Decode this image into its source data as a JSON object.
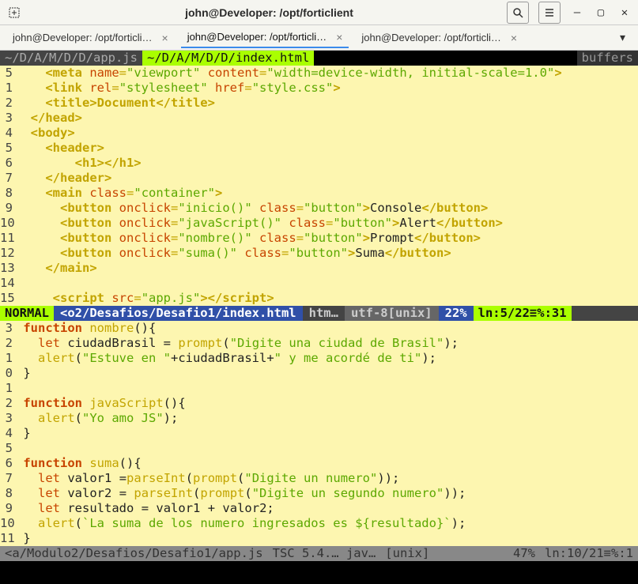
{
  "window": {
    "title": "john@Developer: /opt/forticlient",
    "controls": {
      "minimize": "—",
      "maximize": "▢",
      "close": "✕",
      "search": "🔍",
      "menu": "≡"
    }
  },
  "tabs": [
    {
      "label": "john@Developer: /opt/forticli…",
      "active": false
    },
    {
      "label": "john@Developer: /opt/forticli…",
      "active": true
    },
    {
      "label": "john@Developer: /opt/forticli…",
      "active": false
    }
  ],
  "buftabs": {
    "left": "~/D/A/M/D/D/app.js",
    "active": "~/D/A/M/D/D/index.html",
    "right": "buffers"
  },
  "pane1": {
    "lines": [
      {
        "n": "5"
      },
      {
        "n": "1"
      },
      {
        "n": "2"
      },
      {
        "n": "3"
      },
      {
        "n": "4"
      },
      {
        "n": "5"
      },
      {
        "n": "6"
      },
      {
        "n": "7"
      },
      {
        "n": "8"
      },
      {
        "n": "9"
      },
      {
        "n": "10"
      },
      {
        "n": "11"
      },
      {
        "n": "12"
      },
      {
        "n": "13"
      },
      {
        "n": "14"
      },
      {
        "n": "15"
      }
    ],
    "meta": {
      "name": "viewport",
      "content": "width=device-width, initial-scale=1.0"
    },
    "link": {
      "rel": "stylesheet",
      "href": "style.css"
    },
    "title": "Document",
    "main_class": "container",
    "buttons": [
      {
        "onclick": "inicio()",
        "class": "button",
        "text": "Console"
      },
      {
        "onclick": "javaScript()",
        "class": "button",
        "text": "Alert"
      },
      {
        "onclick": "nombre()",
        "class": "button",
        "text": "Prompt"
      },
      {
        "onclick": "suma()",
        "class": "button",
        "text": "Suma"
      }
    ],
    "script_src": "app.js"
  },
  "statusline1": {
    "mode": "NORMAL",
    "file": "<o2/Desafios/Desafio1/index.html",
    "ft": "htm…",
    "enc": "utf-8[unix]",
    "pct": "22%",
    "pos": "ln:5/22≡%:31"
  },
  "pane2": {
    "lines": [
      {
        "n": "3"
      },
      {
        "n": "2"
      },
      {
        "n": "1"
      },
      {
        "n": "0"
      },
      {
        "n": "1"
      },
      {
        "n": "2"
      },
      {
        "n": "3"
      },
      {
        "n": "4"
      },
      {
        "n": "5"
      },
      {
        "n": "6"
      },
      {
        "n": "7"
      },
      {
        "n": "8"
      },
      {
        "n": "9"
      },
      {
        "n": "10"
      },
      {
        "n": "11"
      }
    ],
    "fn_nombre": {
      "name": "nombre",
      "var": "ciudadBrasil",
      "prompt_str": "\"Digite una ciudad de Brasil\"",
      "alert_a": "\"Estuve en \"",
      "alert_b": "ciudadBrasil",
      "alert_c": "\" y me acordé de ti\""
    },
    "fn_js": {
      "name": "javaScript",
      "alert": "\"Yo amo JS\""
    },
    "fn_suma": {
      "name": "suma",
      "v1": "valor1",
      "p1": "\"Digite un numero\"",
      "v2": "valor2",
      "p2": "\"Digite un segundo numero\"",
      "res": "resultado",
      "tmpl": "`La suma de los numero ingresados es ${resultado}`"
    }
  },
  "statusline2": {
    "file": "<a/Modulo2/Desafios/Desafio1/app.js",
    "ft": "TSC 5.4.…  jav…",
    "enc": "[unix]",
    "pct": "47%",
    "pos": "ln:10/21≡%:1"
  }
}
